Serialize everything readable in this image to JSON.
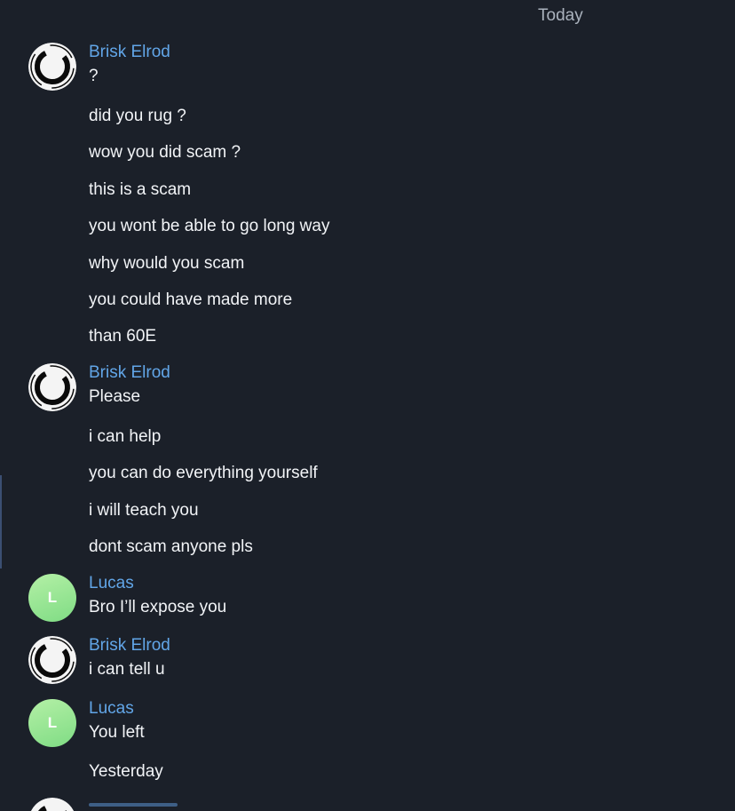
{
  "day_separator": "Today",
  "messages": [
    {
      "sender": "Brisk Elrod",
      "avatar": "ring-logo-icon",
      "lines": [
        "?",
        "did you rug ?",
        "wow you did scam ?",
        "this is a scam",
        "you wont be able to go long way",
        "why would you scam",
        "you could have made more",
        "than 60E"
      ]
    },
    {
      "sender": "Brisk Elrod",
      "avatar": "ring-logo-icon",
      "lines": [
        "Please",
        "i can help",
        "you can do everything yourself",
        "i will teach you",
        "dont scam anyone pls"
      ]
    },
    {
      "sender": "Lucas",
      "avatar_letter": "L",
      "lines": [
        "Bro I’ll expose you"
      ]
    },
    {
      "sender": "Brisk Elrod",
      "avatar": "ring-logo-icon",
      "lines": [
        "i can tell u"
      ]
    },
    {
      "sender": "Lucas",
      "avatar_letter": "L",
      "lines": [
        "You left",
        "Yesterday"
      ]
    }
  ],
  "colors": {
    "background": "#1b2029",
    "sender_name": "#62a6e8",
    "message_text": "#f2f4f7",
    "day_label": "#aab2bd",
    "lucas_avatar": "#8fe38d"
  }
}
